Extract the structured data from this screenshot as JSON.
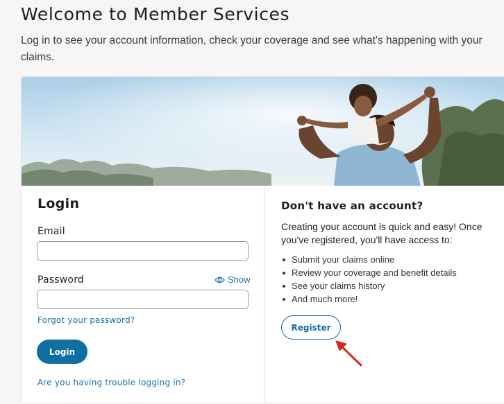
{
  "header": {
    "title": "Welcome to Member Services",
    "intro": "Log in to see your account information, check your coverage and see what's happening with your claims."
  },
  "hero": {
    "image_description_icon": "family-photo"
  },
  "login": {
    "title": "Login",
    "email_label": "Email",
    "email_value": "",
    "password_label": "Password",
    "password_value": "",
    "show_label": "Show",
    "forgot_label": "Forgot your password?",
    "login_button": "Login",
    "trouble_label": "Are you having trouble logging in?"
  },
  "register": {
    "title": "Don't have an account?",
    "text": "Creating your account is quick and easy! Once you've registered, you'll have access to:",
    "benefits": [
      "Submit your claims online",
      "Review your coverage and benefit details",
      "See your claims history",
      "And much more!"
    ],
    "register_button": "Register"
  },
  "colors": {
    "accent": "#0e6fa3",
    "annotation": "#d9261c",
    "background": "#f6f6f6"
  }
}
